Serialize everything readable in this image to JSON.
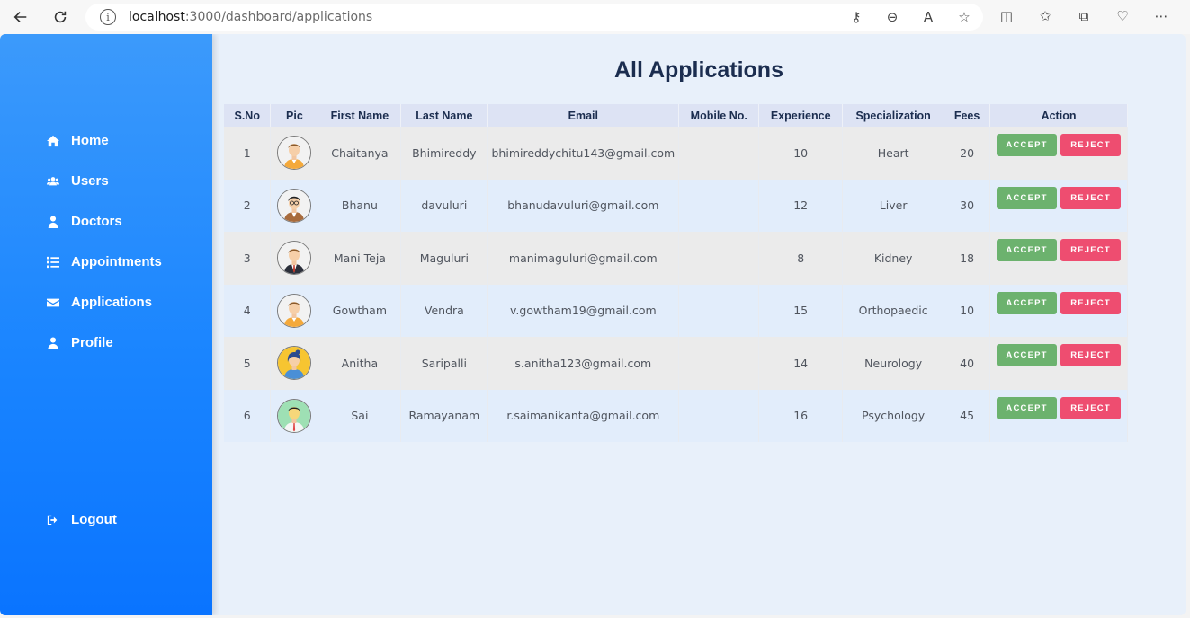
{
  "browser": {
    "url_host": "localhost",
    "url_path": ":3000/dashboard/applications"
  },
  "sidebar": {
    "items": [
      {
        "label": "Home",
        "icon": "home-icon"
      },
      {
        "label": "Users",
        "icon": "users-icon"
      },
      {
        "label": "Doctors",
        "icon": "doctor-icon"
      },
      {
        "label": "Appointments",
        "icon": "list-icon"
      },
      {
        "label": "Applications",
        "icon": "envelope-icon"
      },
      {
        "label": "Profile",
        "icon": "user-icon"
      }
    ],
    "logout": {
      "label": "Logout",
      "icon": "logout-icon"
    }
  },
  "main": {
    "title": "All Applications",
    "columns": [
      "S.No",
      "Pic",
      "First Name",
      "Last Name",
      "Email",
      "Mobile No.",
      "Experience",
      "Specialization",
      "Fees",
      "Action"
    ],
    "accept_label": "ACCEPT",
    "reject_label": "REJECT",
    "rows": [
      {
        "sno": "1",
        "first": "Chaitanya",
        "last": "Bhimireddy",
        "email": "bhimireddychitu143@gmail.com",
        "mobile": "",
        "experience": "10",
        "specialization": "Heart",
        "fees": "20",
        "avatar": "man-yellow-shirt"
      },
      {
        "sno": "2",
        "first": "Bhanu",
        "last": "davuluri",
        "email": "bhanudavuluri@gmail.com",
        "mobile": "",
        "experience": "12",
        "specialization": "Liver",
        "fees": "30",
        "avatar": "man-glasses-brown"
      },
      {
        "sno": "3",
        "first": "Mani Teja",
        "last": "Maguluri",
        "email": "manimaguluri@gmail.com",
        "mobile": "",
        "experience": "8",
        "specialization": "Kidney",
        "fees": "18",
        "avatar": "man-suit"
      },
      {
        "sno": "4",
        "first": "Gowtham",
        "last": "Vendra",
        "email": "v.gowtham19@gmail.com",
        "mobile": "",
        "experience": "15",
        "specialization": "Orthopaedic",
        "fees": "10",
        "avatar": "man-yellow-shirt"
      },
      {
        "sno": "5",
        "first": "Anitha",
        "last": "Saripalli",
        "email": "s.anitha123@gmail.com",
        "mobile": "",
        "experience": "14",
        "specialization": "Neurology",
        "fees": "40",
        "avatar": "woman-yellow-bg"
      },
      {
        "sno": "6",
        "first": "Sai",
        "last": "Ramayanam",
        "email": "r.saimanikanta@gmail.com",
        "mobile": "",
        "experience": "16",
        "specialization": "Psychology",
        "fees": "45",
        "avatar": "man-green-bg"
      }
    ]
  },
  "colors": {
    "sidebar_top": "#3c9afb",
    "sidebar_bottom": "#0a74ff",
    "accept": "#6cb26e",
    "reject": "#ee4d70",
    "title": "#1b2d4f"
  }
}
